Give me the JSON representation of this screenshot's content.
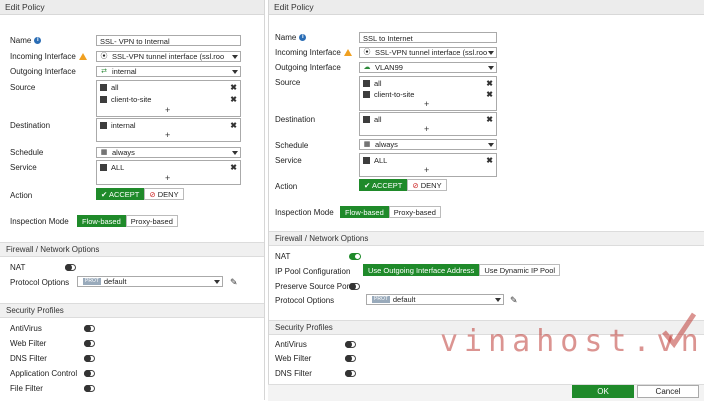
{
  "left": {
    "title": "Edit Policy",
    "fields": {
      "name_label": "Name",
      "name_value": "SSL- VPN to Internal",
      "incoming_label": "Incoming Interface",
      "incoming_value": "SSL-VPN tunnel interface (ssl.roo",
      "outgoing_label": "Outgoing Interface",
      "outgoing_value": "internal",
      "source_label": "Source",
      "source_items": [
        "all",
        "client-to-site"
      ],
      "destination_label": "Destination",
      "destination_items": [
        "internal"
      ],
      "schedule_label": "Schedule",
      "schedule_value": "always",
      "service_label": "Service",
      "service_items": [
        "ALL"
      ],
      "action_label": "Action",
      "accept": "ACCEPT",
      "deny": "DENY",
      "inspection_label": "Inspection Mode",
      "flow": "Flow-based",
      "proxy": "Proxy-based"
    },
    "firewall_section": "Firewall / Network Options",
    "nat_label": "NAT",
    "protocol_label": "Protocol Options",
    "protocol_badge": "PROT",
    "protocol_value": "default",
    "security_section": "Security Profiles",
    "profiles": [
      "AntiVirus",
      "Web Filter",
      "DNS Filter",
      "Application Control",
      "File Filter"
    ]
  },
  "right": {
    "title": "Edit Policy",
    "fields": {
      "name_label": "Name",
      "name_value": "SSL to Internet",
      "incoming_label": "Incoming Interface",
      "incoming_value": "SSL-VPN tunnel interface (ssl.roo",
      "outgoing_label": "Outgoing Interface",
      "outgoing_value": "VLAN99",
      "source_label": "Source",
      "source_items": [
        "all",
        "client-to-site"
      ],
      "destination_label": "Destination",
      "destination_items": [
        "all"
      ],
      "schedule_label": "Schedule",
      "schedule_value": "always",
      "service_label": "Service",
      "service_items": [
        "ALL"
      ],
      "action_label": "Action",
      "accept": "ACCEPT",
      "deny": "DENY",
      "inspection_label": "Inspection Mode",
      "flow": "Flow-based",
      "proxy": "Proxy-based"
    },
    "firewall_section": "Firewall / Network Options",
    "nat_label": "NAT",
    "ippool_label": "IP Pool Configuration",
    "ippool_outgoing": "Use Outgoing Interface Address",
    "ippool_dynamic": "Use Dynamic IP Pool",
    "preserve_label": "Preserve Source Port",
    "protocol_label": "Protocol Options",
    "protocol_badge": "PROT",
    "protocol_value": "default",
    "security_section": "Security Profiles",
    "profiles": [
      "AntiVirus",
      "Web Filter",
      "DNS Filter"
    ]
  },
  "footer": {
    "ok": "OK",
    "cancel": "Cancel"
  },
  "watermark": "vinahost.vn",
  "colors": {
    "accent_green": "#1f8a2a",
    "info_blue": "#2a6db5",
    "warning": "#f0a020"
  }
}
